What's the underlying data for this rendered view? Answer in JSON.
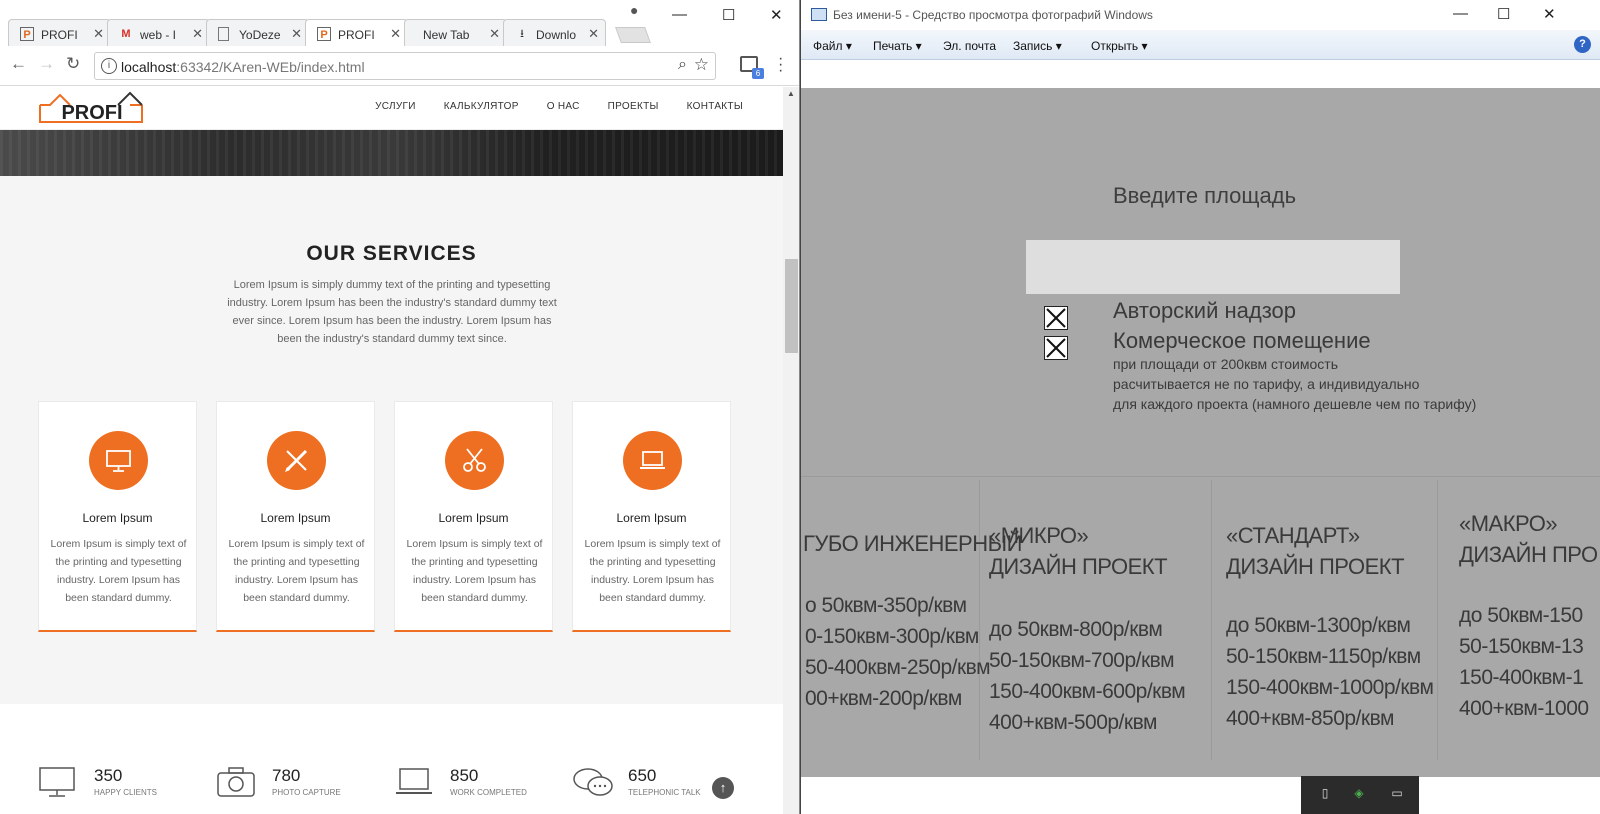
{
  "browser": {
    "tabs": [
      {
        "label": "PROFI",
        "icon": "profi-favicon-icon",
        "active": false
      },
      {
        "label": "web - I",
        "icon": "gmail-icon",
        "active": false
      },
      {
        "label": "YoDeze",
        "icon": "document-icon",
        "active": false
      },
      {
        "label": "PROFI",
        "icon": "profi-favicon-icon",
        "active": true
      },
      {
        "label": "New Tab",
        "icon": "",
        "active": false
      },
      {
        "label": "Downlo",
        "icon": "download-icon",
        "active": false
      }
    ],
    "address": {
      "host": "localhost",
      "rest": ":63342/KAren-WEb/index.html"
    },
    "extension_badge": "6"
  },
  "site": {
    "logo_text": "PROFI",
    "nav": [
      "УСЛУГИ",
      "КАЛЬКУЛЯТОР",
      "О НАС",
      "ПРОЕКТЫ",
      "КОНТАКТЫ"
    ],
    "accent_color": "#ee6f22",
    "services": {
      "title": "OUR SERVICES",
      "description": "Lorem Ipsum is simply dummy text of the printing and typesetting industry. Lorem Ipsum has been the industry's standard dummy text ever since. Lorem Ipsum has been the industry. Lorem Ipsum has been the industry's standard dummy text since.",
      "cards": [
        {
          "icon": "monitor-icon",
          "title": "Lorem Ipsum",
          "text": "Lorem Ipsum is simply text of the printing and typesetting industry. Lorem Ipsum has been standard dummy."
        },
        {
          "icon": "pencil-ruler-icon",
          "title": "Lorem Ipsum",
          "text": "Lorem Ipsum is simply text of the printing and typesetting industry. Lorem Ipsum has been standard dummy."
        },
        {
          "icon": "scissors-icon",
          "title": "Lorem Ipsum",
          "text": "Lorem Ipsum is simply text of the printing and typesetting industry. Lorem Ipsum has been standard dummy."
        },
        {
          "icon": "laptop-icon",
          "title": "Lorem Ipsum",
          "text": "Lorem Ipsum is simply text of the printing and typesetting industry. Lorem Ipsum has been standard dummy."
        }
      ]
    },
    "stats": [
      {
        "icon": "monitor-icon",
        "number": "350",
        "label": "HAPPY CLIENTS"
      },
      {
        "icon": "camera-icon",
        "number": "780",
        "label": "PHOTO CAPTURE"
      },
      {
        "icon": "laptop-icon",
        "number": "850",
        "label": "WORK COMPLETED"
      },
      {
        "icon": "chat-icon",
        "number": "650",
        "label": "TELEPHONIC TALK"
      }
    ]
  },
  "viewer": {
    "title": "Без имени-5 - Средство просмотра фотографий Windows",
    "menu": [
      "Файл",
      "Печать",
      "Эл. почта",
      "Запись",
      "Открыть"
    ],
    "photo": {
      "heading": "Введите площадь",
      "option1": "Авторский надзор",
      "option2": "Комерческое помещение",
      "note": [
        "при площади от 200квм стоимость",
        "расчитывается не по тарифу, а индивидуально",
        "для каждого проекта (намного дешевле чем по тарифу)"
      ],
      "columns": [
        {
          "head": [
            "ГУБО ИНЖЕНЕРНЫЙ"
          ],
          "lines": [
            "о 50квм-350р/квм",
            "0-150квм-300р/квм",
            "50-400квм-250р/квм",
            "00+квм-200р/квм"
          ]
        },
        {
          "head": [
            "«МИКРО»",
            "ДИЗАЙН ПРОЕКТ"
          ],
          "lines": [
            "до 50квм-800р/квм",
            "50-150квм-700р/квм",
            "150-400квм-600р/квм",
            "400+квм-500р/квм"
          ]
        },
        {
          "head": [
            "«СТАНДАРТ»",
            "ДИЗАЙН ПРОЕКТ"
          ],
          "lines": [
            "до 50квм-1300р/квм",
            "50-150квм-1150р/квм",
            "150-400квм-1000р/квм",
            "400+квм-850р/квм"
          ]
        },
        {
          "head": [
            "«МАКРО»",
            "ДИЗАЙН ПРО"
          ],
          "lines": [
            "до 50квм-150",
            "50-150квм-13",
            "150-400квм-1",
            "400+квм-1000"
          ]
        }
      ]
    }
  }
}
